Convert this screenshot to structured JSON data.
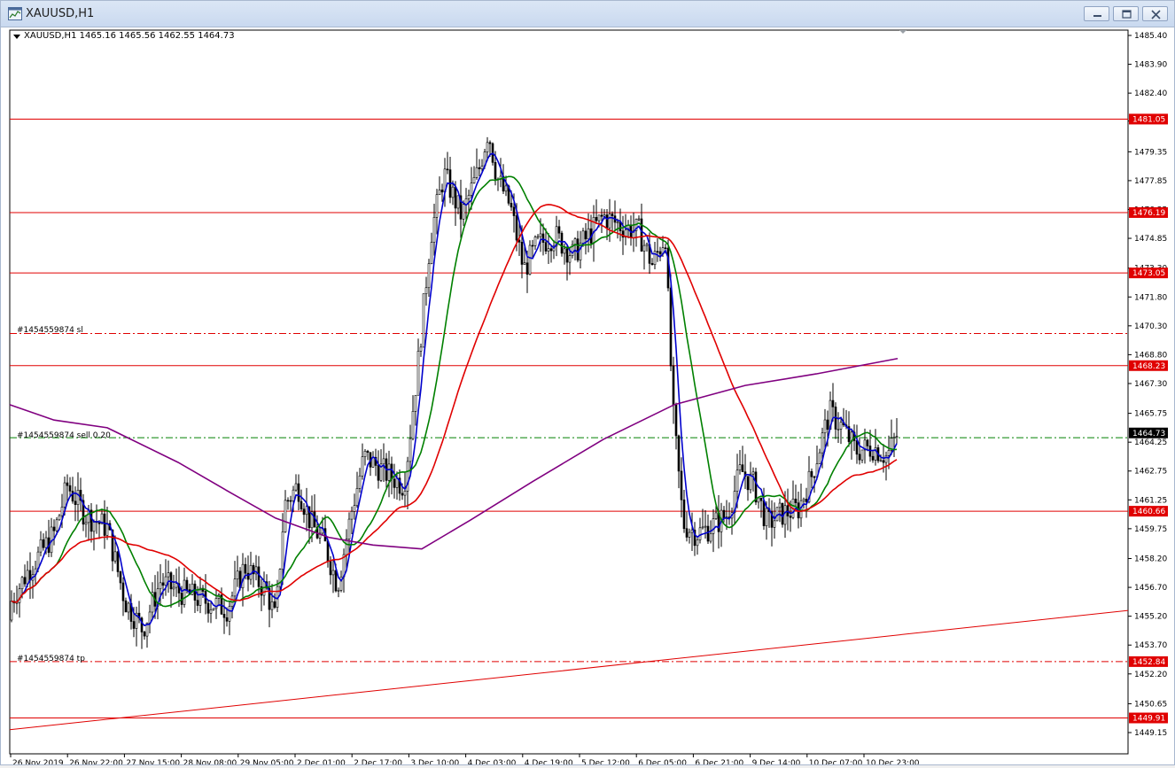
{
  "window": {
    "title": "XAUUSD,H1",
    "controls": [
      "minimize-icon",
      "restore-icon",
      "close-icon"
    ]
  },
  "chart": {
    "symbol_info": "XAUUSD,H1  1465.16 1465.56 1462.55 1464.73",
    "price_ticks": [
      "1485.40",
      "1483.90",
      "1482.40",
      "1480.95",
      "1479.35",
      "1477.85",
      "1476.35",
      "1474.85",
      "1473.30",
      "1471.80",
      "1470.30",
      "1468.80",
      "1467.30",
      "1465.75",
      "1464.25",
      "1462.75",
      "1461.25",
      "1459.75",
      "1458.20",
      "1456.70",
      "1455.20",
      "1453.70",
      "1452.20",
      "1450.65",
      "1449.15"
    ],
    "time_ticks": [
      "26 Nov 2019",
      "26 Nov 22:00",
      "27 Nov 15:00",
      "28 Nov 08:00",
      "29 Nov 05:00",
      "2 Dec 01:00",
      "2 Dec 17:00",
      "3 Dec 10:00",
      "4 Dec 03:00",
      "4 Dec 19:00",
      "5 Dec 12:00",
      "6 Dec 05:00",
      "6 Dec 21:00",
      "9 Dec 14:00",
      "10 Dec 07:00",
      "10 Dec 23:00"
    ],
    "horizontal_levels": [
      {
        "price": "1481.05",
        "style": "solid",
        "color": "#e00000"
      },
      {
        "price": "1476.19",
        "style": "solid",
        "color": "#e00000"
      },
      {
        "price": "1473.05",
        "style": "solid",
        "color": "#e00000"
      },
      {
        "price": "1468.23",
        "style": "solid",
        "color": "#e00000"
      },
      {
        "price": "1460.66",
        "style": "solid",
        "color": "#e00000"
      },
      {
        "price": "1452.84",
        "style": "dashdot",
        "color": "#e00000"
      },
      {
        "price": "1449.91",
        "style": "solid",
        "color": "#e00000"
      }
    ],
    "current_price": {
      "price": "1464.73",
      "color": "#000000"
    },
    "order_lines": {
      "sl_label": "#1454559874 sl",
      "sell_label": "#1454559874 sell 0.20",
      "tp_label": "#1454559874 tp"
    },
    "colors": {
      "candle": "#000000",
      "ma_fast": "#0000cc",
      "ma_mid": "#008000",
      "ma_slow": "#e00000",
      "ma_long": "#800080",
      "level": "#e00000",
      "sell_line": "#008000"
    }
  }
}
